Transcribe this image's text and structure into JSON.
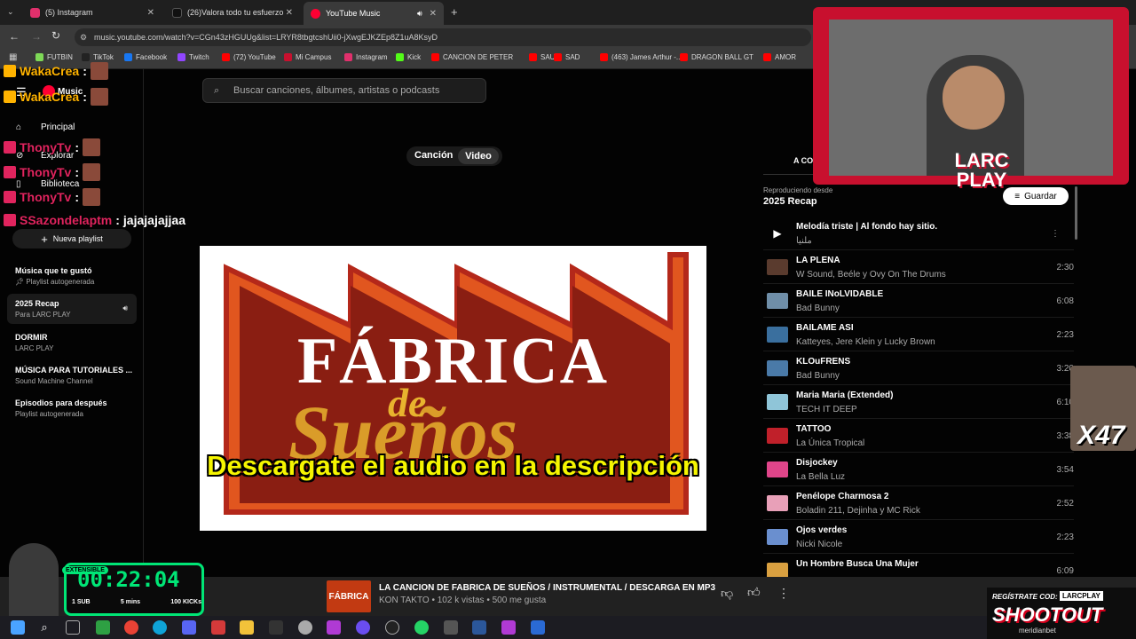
{
  "browser": {
    "tabs": [
      {
        "label": "(5) Instagram",
        "color": "#e1306c"
      },
      {
        "label": "(26)Valora todo tu esfuerzo por",
        "color": "#111111"
      },
      {
        "label": "YouTube Music",
        "color": "#ff0033"
      }
    ],
    "url": "music.youtube.com/watch?v=CGn43zHGUUg&list=LRYR8tbgtcshUii0-jXwgEJKZEp8Z1uA8KsyD",
    "bookmarks": [
      {
        "label": "FUTBIN",
        "color": "#7ed957"
      },
      {
        "label": "TikTok",
        "color": "#222222"
      },
      {
        "label": "Facebook",
        "color": "#1877f2"
      },
      {
        "label": "Twitch",
        "color": "#9146ff"
      },
      {
        "label": "(72) YouTube",
        "color": "#ff0000"
      },
      {
        "label": "Mi Campus",
        "color": "#c8102e"
      },
      {
        "label": "Instagram",
        "color": "#e1306c"
      },
      {
        "label": "Kick",
        "color": "#53fc18"
      },
      {
        "label": "CANCION DE PETER",
        "color": "#ff0000"
      },
      {
        "label": "SAU",
        "color": "#ff0000"
      },
      {
        "label": "SAD",
        "color": "#ff0000"
      },
      {
        "label": "(463) James Arthur -...",
        "color": "#ff0000"
      },
      {
        "label": "DRAGON BALL GT",
        "color": "#ff0000"
      },
      {
        "label": "AMOR",
        "color": "#ff0000"
      }
    ]
  },
  "app": {
    "logo": "Music",
    "search_placeholder": "Buscar canciones, álbumes, artistas o podcasts",
    "nav": [
      "Principal",
      "Explorar",
      "Biblioteca"
    ],
    "new_playlist": "Nueva playlist",
    "playlists": [
      {
        "title": "Música que te gustó",
        "sub": "Playlist autogenerada"
      },
      {
        "title": "2025 Recap",
        "sub": "Para LARC PLAY"
      },
      {
        "title": "DORMIR",
        "sub": "LARC PLAY"
      },
      {
        "title": "MÚSICA PARA TUTORIALES ...",
        "sub": "Sound Machine Channel"
      },
      {
        "title": "Episodios para después",
        "sub": "Playlist autogenerada"
      }
    ],
    "toggle": {
      "song": "Canción",
      "video": "Video"
    },
    "video": {
      "title_line1": "FÁBRICA",
      "title_line2": "de",
      "title_line3": "Sueños",
      "caption": "Descargate el audio en la descripción"
    },
    "queue": {
      "tab": "A CO",
      "playing_from_label": "Reproduciendo desde",
      "playing_from": "2025 Recap",
      "save": "Guardar",
      "items": [
        {
          "title": "Melodía triste | Al fondo hay sitio.",
          "artist": "ملنيا",
          "duration": "",
          "thumb": "#333333"
        },
        {
          "title": "LA PLENA",
          "artist": "W Sound, Beéle y Ovy On The Drums",
          "duration": "2:30",
          "thumb": "#5a3b2e"
        },
        {
          "title": "BAILE INoLVIDABLE",
          "artist": "Bad Bunny",
          "duration": "6:08",
          "thumb": "#6f8ea8"
        },
        {
          "title": "BAILAME ASI",
          "artist": "Katteyes, Jere Klein y Lucky Brown",
          "duration": "2:23",
          "thumb": "#3a6f9e"
        },
        {
          "title": "KLOuFRENS",
          "artist": "Bad Bunny",
          "duration": "3:20",
          "thumb": "#4a7aa8"
        },
        {
          "title": "Maria Maria (Extended)",
          "artist": "TECH IT DEEP",
          "duration": "6:10",
          "thumb": "#8fc5d8"
        },
        {
          "title": "TATTOO",
          "artist": "La Única Tropical",
          "duration": "3:38",
          "thumb": "#c0202a"
        },
        {
          "title": "Disjockey",
          "artist": "La Bella Luz",
          "duration": "3:54",
          "thumb": "#e0458a"
        },
        {
          "title": "Penélope Charmosa 2",
          "artist": "Boladin 211, Dejinha y MC Rick",
          "duration": "2:52",
          "thumb": "#e8a0b8"
        },
        {
          "title": "Ojos verdes",
          "artist": "Nicki Nicole",
          "duration": "2:23",
          "thumb": "#6a8fcf"
        },
        {
          "title": "Un Hombre Busca Una Mujer",
          "artist": "",
          "duration": "6:09",
          "thumb": "#d9a040"
        }
      ]
    },
    "player": {
      "title": "LA CANCION DE FABRICA DE SUEÑOS / INSTRUMENTAL / DESCARGA EN MP3",
      "meta": "KON TAKTO • 102 k vistas • 500 me gusta",
      "thumb_text": "FÁBRICA"
    }
  },
  "overlay": {
    "chat": [
      {
        "name": "WakaCrea",
        "color": "#ffb300"
      },
      {
        "name": "WakaCrea",
        "color": "#ffb300"
      },
      {
        "name": "ThonyTv",
        "color": "#e0245e"
      },
      {
        "name": "ThonyTv",
        "color": "#e0245e"
      },
      {
        "name": "ThonyTv",
        "color": "#e0245e"
      },
      {
        "name": "SSazondelaptm",
        "color": "#e0245e",
        "message": "jajajajajjaa"
      }
    ],
    "webcam_logo_1": "LARC",
    "webcam_logo_2": "PLAY",
    "timer": "00:22:04",
    "timer_label": "EXTENSIBLE",
    "timer_stats": [
      "1 SUB",
      "5 mins",
      "100 KICKs"
    ],
    "emote_count": "X47",
    "promo_label": "REGÍSTRATE COD:",
    "promo_code": "LARCPLAY",
    "promo_brand": "SHOOTOUT",
    "promo_sub": "meridianbet"
  }
}
